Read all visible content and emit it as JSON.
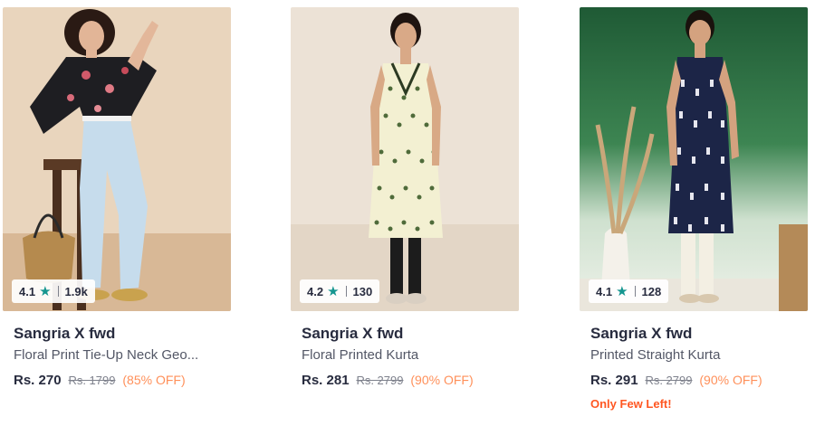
{
  "products": [
    {
      "brand": "Sangria X fwd",
      "name": "Floral Print Tie-Up Neck Geo...",
      "price": "Rs. 270",
      "mrp": "Rs. 1799",
      "discount": "(85% OFF)",
      "rating": "4.1",
      "rating_count": "1.9k",
      "stock_note": "",
      "image_icon": "model-photo-floral-top-jeans"
    },
    {
      "brand": "Sangria X fwd",
      "name": "Floral Printed Kurta",
      "price": "Rs. 281",
      "mrp": "Rs. 2799",
      "discount": "(90% OFF)",
      "rating": "4.2",
      "rating_count": "130",
      "stock_note": "",
      "image_icon": "model-photo-cream-kurta"
    },
    {
      "brand": "Sangria X fwd",
      "name": "Printed Straight Kurta",
      "price": "Rs. 291",
      "mrp": "Rs. 2799",
      "discount": "(90% OFF)",
      "rating": "4.1",
      "rating_count": "128",
      "stock_note": "Only Few Left!",
      "image_icon": "model-photo-navy-kurta"
    }
  ],
  "colors": {
    "star": "#14958f",
    "discount": "#ff905a",
    "stock_note": "#ff5722"
  }
}
